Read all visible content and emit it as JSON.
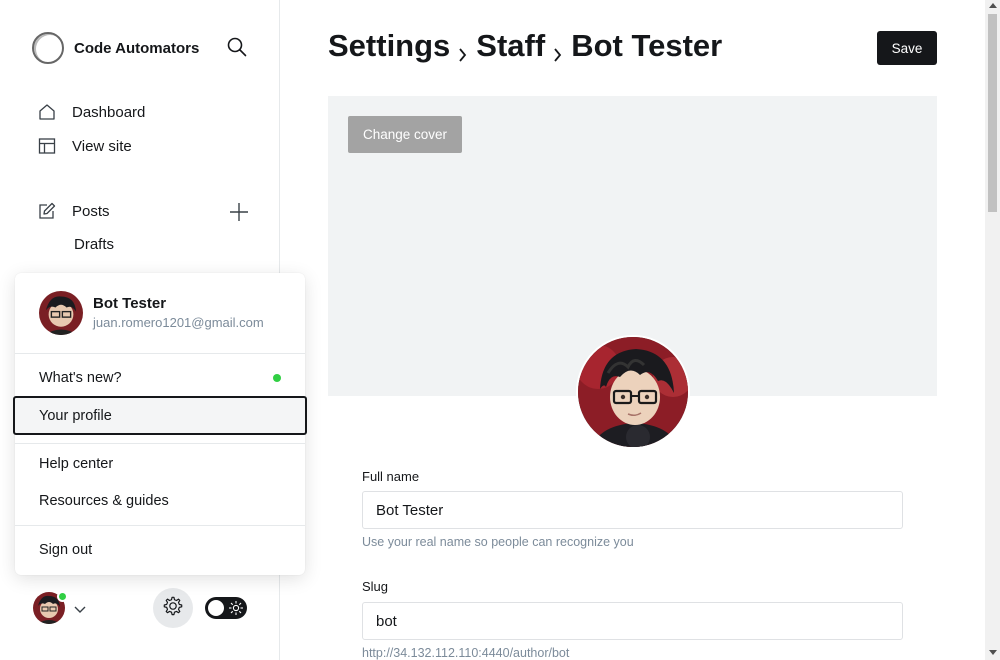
{
  "brand": {
    "name": "Code Automators"
  },
  "nav": {
    "dashboard": "Dashboard",
    "view_site": "View site",
    "posts": "Posts",
    "drafts": "Drafts"
  },
  "popup": {
    "user_name": "Bot Tester",
    "user_email": "juan.romero1201@gmail.com",
    "items": [
      "What's new?",
      "Your profile",
      "Help center",
      "Resources & guides",
      "Sign out"
    ]
  },
  "header": {
    "crumbs": [
      "Settings",
      "Staff",
      "Bot Tester"
    ],
    "save_label": "Save"
  },
  "cover": {
    "change_label": "Change cover"
  },
  "form": {
    "full_name_label": "Full name",
    "full_name_value": "Bot Tester",
    "full_name_hint": "Use your real name so people can recognize you",
    "slug_label": "Slug",
    "slug_value": "bot",
    "slug_hint": "http://34.132.112.110:4440/author/bot"
  },
  "colors": {
    "accent": "#15171a",
    "online": "#30cf43",
    "muted": "#7c8b9a"
  },
  "icons": [
    "search-icon",
    "home-icon",
    "layout-icon",
    "edit-icon",
    "plus-icon",
    "gear-icon",
    "chevron-down-icon",
    "sun-icon",
    "chevron-right-icon"
  ]
}
